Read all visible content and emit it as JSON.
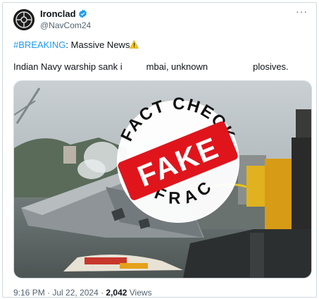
{
  "post": {
    "author_name": "Ironclad",
    "handle": "@NavCom24",
    "more_label": "···",
    "hashtag": "#BREAKING",
    "headline_rest": ": Massive News",
    "body_text": "Indian Navy warship sank i",
    "body_text_mid": "mbai, unknown",
    "body_text_end": "plosives.",
    "timestamp": "9:16 PM · Jul 22, 2024 · ",
    "views_count": "2,042",
    "views_label": " Views"
  },
  "stamp": {
    "top_text": "FACT CHECK",
    "label": "FAKE",
    "bottom_text": "DFRAC"
  },
  "colors": {
    "link": "#1d9bf0",
    "stamp_red": "#e0151c",
    "verified": "#1d9bf0"
  },
  "icons": {
    "verified": "verified-badge-icon",
    "warning": "warning-emoji-icon",
    "more": "more-options-icon"
  }
}
